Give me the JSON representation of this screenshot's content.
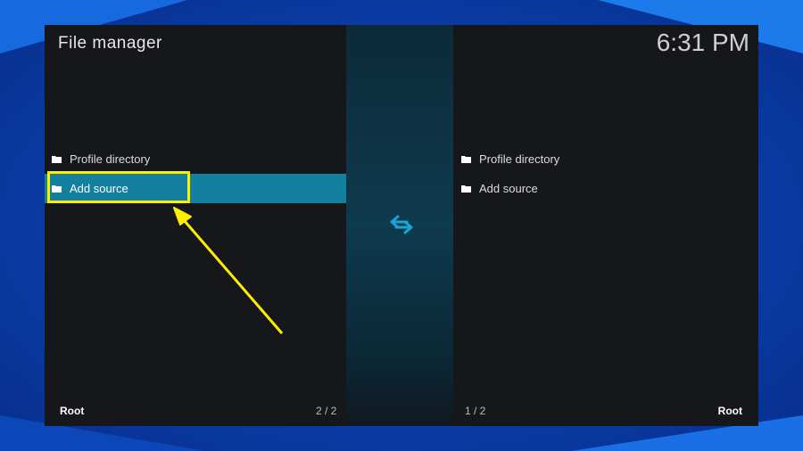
{
  "window": {
    "title": "File manager",
    "clock": "6:31 PM"
  },
  "left_pane": {
    "items": [
      {
        "label": "Profile directory",
        "icon": "folder-icon"
      },
      {
        "label": "Add source",
        "icon": "folder-icon",
        "selected": true
      }
    ],
    "footer_label": "Root",
    "footer_count": "2 / 2"
  },
  "right_pane": {
    "items": [
      {
        "label": "Profile directory",
        "icon": "folder-icon"
      },
      {
        "label": "Add source",
        "icon": "folder-icon"
      }
    ],
    "footer_label": "Root",
    "footer_count": "1 / 2"
  },
  "divider": {
    "icon": "swap-arrows-icon"
  },
  "annotation": {
    "color": "#ffee00",
    "shape": "highlight-box-with-arrow"
  },
  "colors": {
    "selection": "#12809e",
    "accent": "#1aa3d6",
    "background": "#0a3fb0"
  }
}
